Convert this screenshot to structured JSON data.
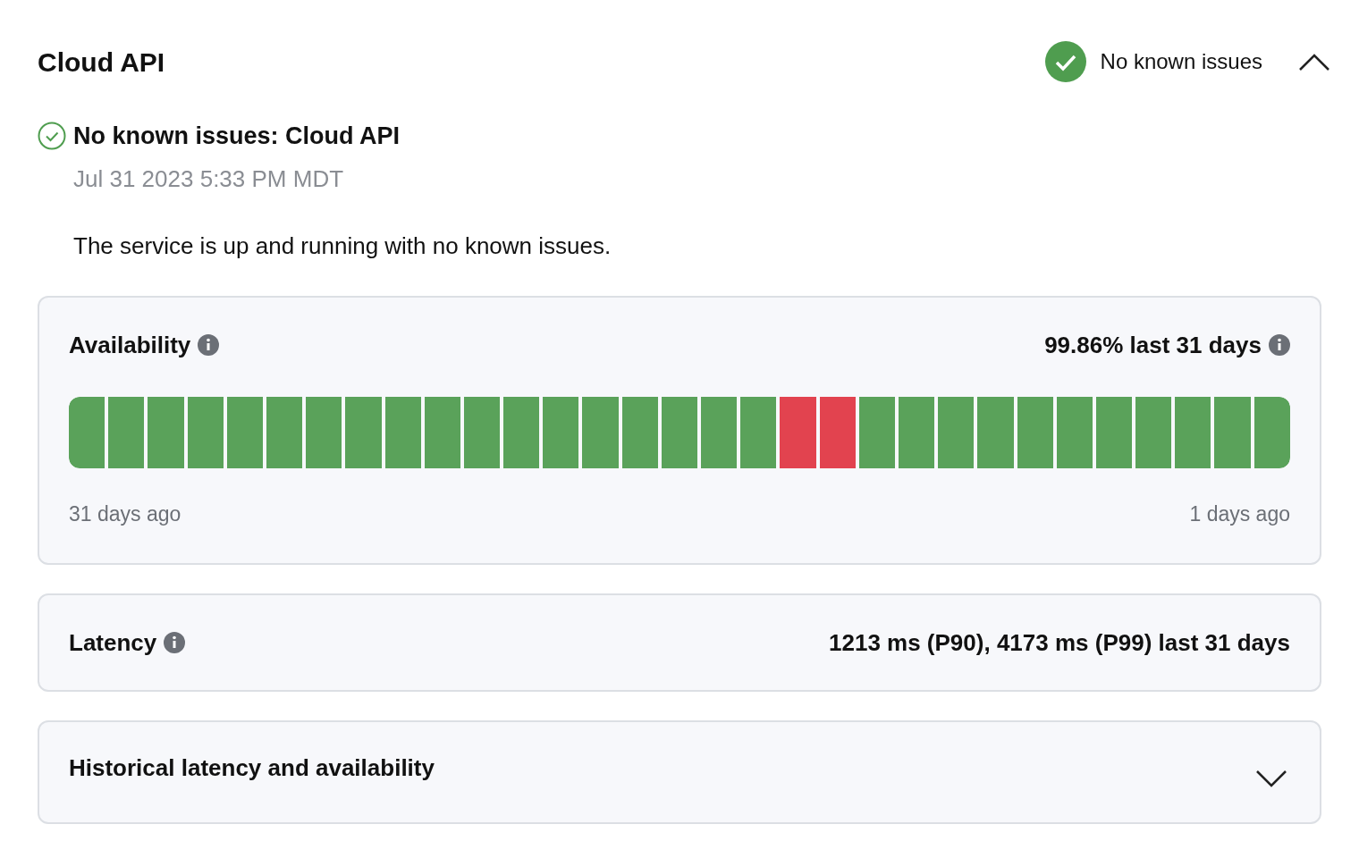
{
  "service": {
    "title": "Cloud API",
    "status": "No known issues",
    "expanded": true
  },
  "incident": {
    "title": "No known issues: Cloud API",
    "time": "Jul 31 2023 5:33 PM MDT",
    "description": "The service is up and running with no known issues."
  },
  "availability": {
    "title": "Availability",
    "summary": "99.86% last 31 days",
    "start_label": "31 days ago",
    "end_label": "1 days ago",
    "days": [
      {
        "color": "#5aa25a"
      },
      {
        "color": "#5aa25a"
      },
      {
        "color": "#5aa25a"
      },
      {
        "color": "#5aa25a"
      },
      {
        "color": "#5aa25a"
      },
      {
        "color": "#5aa25a"
      },
      {
        "color": "#5aa25a"
      },
      {
        "color": "#5aa25a"
      },
      {
        "color": "#5aa25a"
      },
      {
        "color": "#5aa25a"
      },
      {
        "color": "#5aa25a"
      },
      {
        "color": "#5aa25a"
      },
      {
        "color": "#5aa25a"
      },
      {
        "color": "#5aa25a"
      },
      {
        "color": "#5aa25a"
      },
      {
        "color": "#5aa25a"
      },
      {
        "color": "#5aa25a"
      },
      {
        "color": "#5aa25a"
      },
      {
        "color": "#e2434f"
      },
      {
        "color": "#e2434f"
      },
      {
        "color": "#5aa25a"
      },
      {
        "color": "#5aa25a"
      },
      {
        "color": "#5aa25a"
      },
      {
        "color": "#5aa25a"
      },
      {
        "color": "#5aa25a"
      },
      {
        "color": "#5aa25a"
      },
      {
        "color": "#5aa25a"
      },
      {
        "color": "#5aa25a"
      },
      {
        "color": "#5aa25a"
      },
      {
        "color": "#5aa25a"
      },
      {
        "color": "#5aa25a"
      }
    ]
  },
  "latency": {
    "title": "Latency",
    "summary": "1213 ms (P90), 4173 ms (P99) last 31 days"
  },
  "history": {
    "title": "Historical latency and availability",
    "expanded": false
  }
}
